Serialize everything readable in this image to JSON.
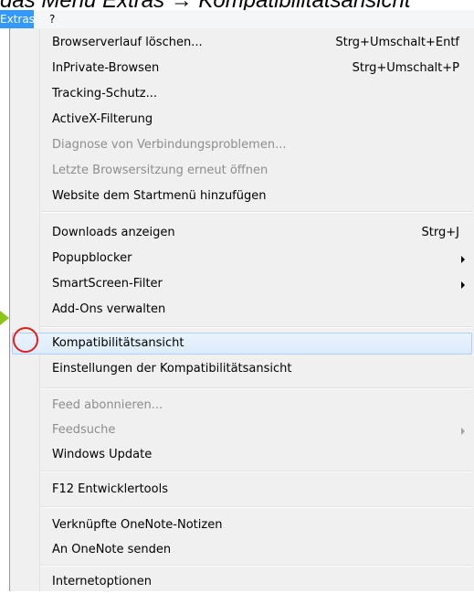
{
  "caption": "das Menü Extras → Kompatibilitätsansicht",
  "menubar": {
    "items": [
      {
        "label": "Extras"
      },
      {
        "label": "?"
      }
    ]
  },
  "menu": {
    "items": [
      {
        "label": "Browserverlauf löschen...",
        "shortcut": "Strg+Umschalt+Entf",
        "enabled": true
      },
      {
        "label": "InPrivate-Browsen",
        "shortcut": "Strg+Umschalt+P",
        "enabled": true
      },
      {
        "label": "Tracking-Schutz...",
        "enabled": true
      },
      {
        "label": "ActiveX-Filterung",
        "enabled": true
      },
      {
        "label": "Diagnose von Verbindungsproblemen...",
        "enabled": false
      },
      {
        "label": "Letzte Browsersitzung erneut öffnen",
        "enabled": false
      },
      {
        "label": "Website dem Startmenü hinzufügen",
        "enabled": true
      },
      {
        "label": "Downloads anzeigen",
        "shortcut": "Strg+J",
        "enabled": true
      },
      {
        "label": "Popupblocker",
        "submenu": true,
        "enabled": true
      },
      {
        "label": "SmartScreen-Filter",
        "submenu": true,
        "enabled": true
      },
      {
        "label": "Add-Ons verwalten",
        "enabled": true
      },
      {
        "label": "Kompatibilitätsansicht",
        "enabled": true,
        "highlighted": true
      },
      {
        "label": "Einstellungen der Kompatibilitätsansicht",
        "enabled": true
      },
      {
        "label": "Feed abonnieren...",
        "enabled": false
      },
      {
        "label": "Feedsuche",
        "submenu": true,
        "enabled": false
      },
      {
        "label": "Windows Update",
        "enabled": true
      },
      {
        "label": "F12 Entwicklertools",
        "enabled": true
      },
      {
        "label": "Verknüpfte OneNote-Notizen",
        "enabled": true
      },
      {
        "label": "An OneNote senden",
        "enabled": true
      },
      {
        "label": "Internetoptionen",
        "enabled": true
      }
    ]
  },
  "colors": {
    "menubar_active": "#3399ff",
    "highlight_border": "#aecff7",
    "annotation_circle": "#e41d1d",
    "annotation_arrow": "#8bc41a"
  }
}
